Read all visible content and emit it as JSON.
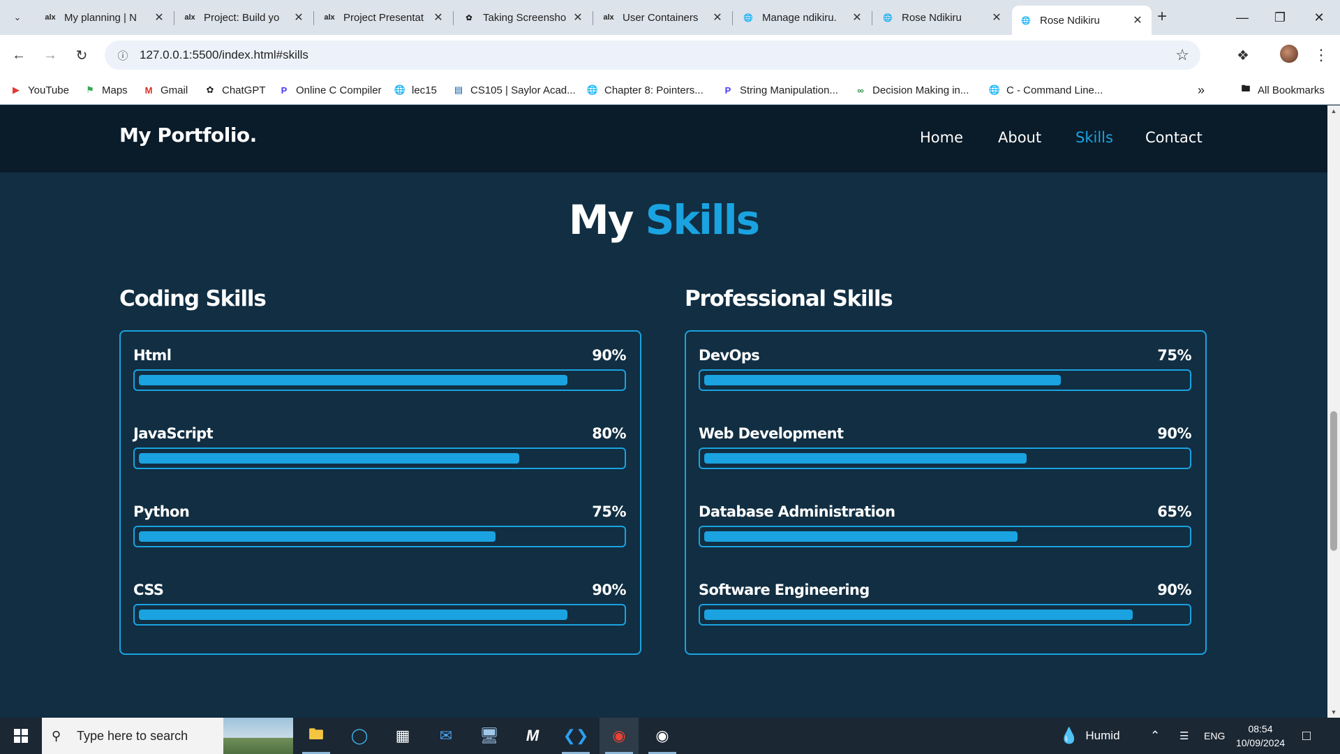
{
  "browser": {
    "tabs": [
      {
        "icon": "alx",
        "title": "My planning | N"
      },
      {
        "icon": "alx",
        "title": "Project: Build yo"
      },
      {
        "icon": "alx",
        "title": "Project Presentat"
      },
      {
        "icon": "openai",
        "title": "Taking Screensho"
      },
      {
        "icon": "alx",
        "title": "User Containers"
      },
      {
        "icon": "globe",
        "title": "Manage ndikiru."
      },
      {
        "icon": "globe",
        "title": "Rose Ndikiru"
      },
      {
        "icon": "globe",
        "title": "Rose Ndikiru"
      }
    ],
    "active_tab_index": 7,
    "url": "127.0.0.1:5500/index.html#skills",
    "bookmarks": [
      {
        "icon": "youtube",
        "label": "YouTube"
      },
      {
        "icon": "maps",
        "label": "Maps"
      },
      {
        "icon": "gmail",
        "label": "Gmail"
      },
      {
        "icon": "openai",
        "label": "ChatGPT"
      },
      {
        "icon": "compiler",
        "label": "Online C Compiler"
      },
      {
        "icon": "globe",
        "label": "lec15"
      },
      {
        "icon": "saylor",
        "label": "CS105 | Saylor Acad..."
      },
      {
        "icon": "globe",
        "label": "Chapter 8: Pointers..."
      },
      {
        "icon": "compiler",
        "label": "String Manipulation..."
      },
      {
        "icon": "geeks",
        "label": "Decision Making in..."
      },
      {
        "icon": "globe",
        "label": "C - Command Line..."
      }
    ],
    "all_bookmarks_label": "All Bookmarks"
  },
  "site": {
    "logo": "My Portfolio.",
    "nav": [
      {
        "label": "Home",
        "active": false
      },
      {
        "label": "About",
        "active": false
      },
      {
        "label": "Skills",
        "active": true
      },
      {
        "label": "Contact",
        "active": false
      }
    ],
    "accent_color": "#1aa3e0",
    "section_title_white": "My",
    "section_title_blue": "Skills",
    "coding": {
      "title": "Coding Skills",
      "skills": [
        {
          "name": "Html",
          "percent_label": "90%",
          "bar_fill": 0.89
        },
        {
          "name": "JavaScript",
          "percent_label": "80%",
          "bar_fill": 0.79
        },
        {
          "name": "Python",
          "percent_label": "75%",
          "bar_fill": 0.74
        },
        {
          "name": "CSS",
          "percent_label": "90%",
          "bar_fill": 0.89
        }
      ]
    },
    "professional": {
      "title": "Professional Skills",
      "skills": [
        {
          "name": "DevOps",
          "percent_label": "75%",
          "bar_fill": 0.74
        },
        {
          "name": "Web Development",
          "percent_label": "90%",
          "bar_fill": 0.67
        },
        {
          "name": "Database Administration",
          "percent_label": "65%",
          "bar_fill": 0.65
        },
        {
          "name": "Software Engineering",
          "percent_label": "90%",
          "bar_fill": 0.89
        }
      ]
    }
  },
  "taskbar": {
    "search_placeholder": "Type here to search",
    "weather": "Humid",
    "language": "ENG",
    "time": "08:54",
    "date": "10/09/2024"
  }
}
